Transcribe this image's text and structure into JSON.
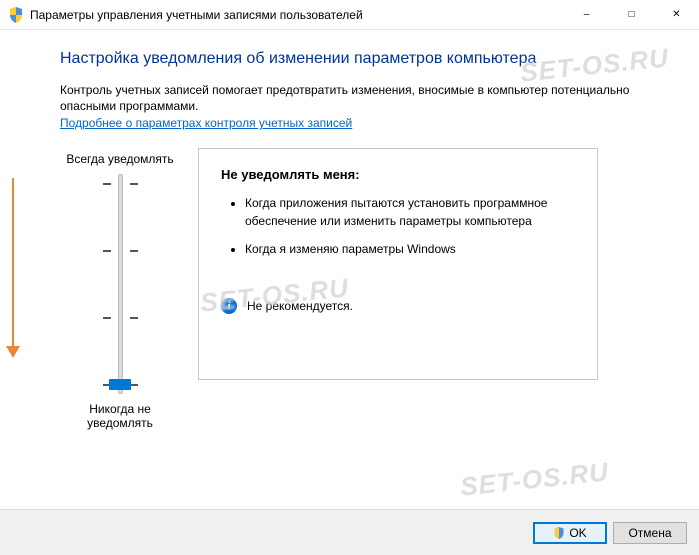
{
  "window": {
    "title": "Параметры управления учетными записями пользователей"
  },
  "page": {
    "heading": "Настройка уведомления об изменении параметров компьютера",
    "intro": "Контроль учетных записей помогает предотвратить изменения, вносимые в компьютер потенциально опасными программами.",
    "link": "Подробнее о параметрах контроля учетных записей"
  },
  "slider": {
    "top_label": "Всегда уведомлять",
    "bottom_label": "Никогда не уведомлять"
  },
  "description": {
    "title": "Не уведомлять меня:",
    "bullets": [
      "Когда приложения пытаются установить программное обеспечение или изменить параметры компьютера",
      "Когда я изменяю параметры Windows"
    ],
    "recommendation": "Не рекомендуется."
  },
  "buttons": {
    "ok": "OK",
    "cancel": "Отмена"
  },
  "watermark": "SET-OS.RU"
}
